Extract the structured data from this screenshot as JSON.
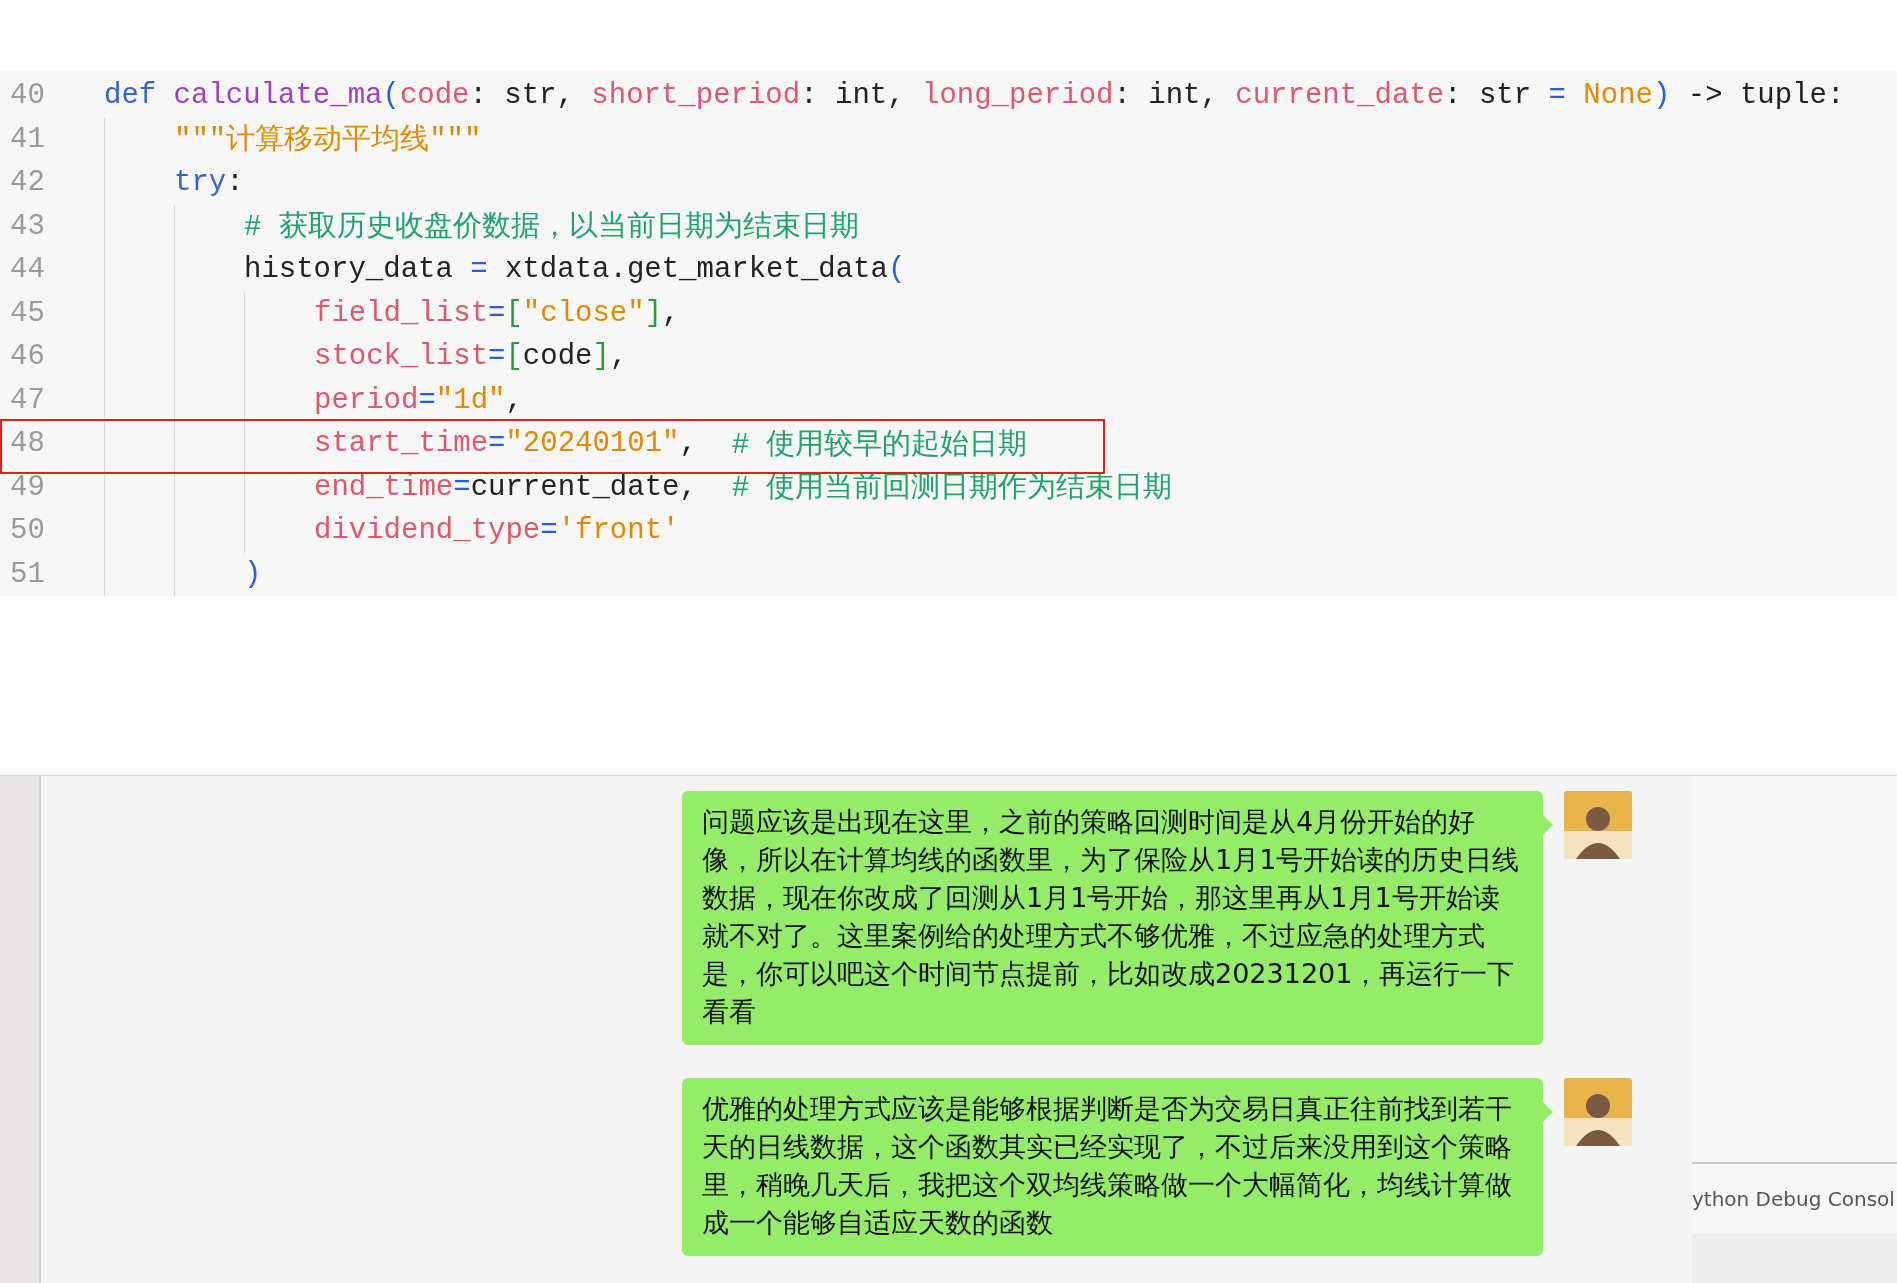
{
  "code_editor": {
    "lines": [
      {
        "number": "40",
        "tokens": [
          {
            "kind": "keyword",
            "text": "def"
          },
          {
            "kind": "function",
            "text": " calculate_ma"
          },
          {
            "kind": "paren",
            "text": "("
          },
          {
            "kind": "param",
            "text": "code"
          },
          {
            "kind": "plain",
            "text": ": str, "
          },
          {
            "kind": "param",
            "text": "short_period"
          },
          {
            "kind": "plain",
            "text": ": int, "
          },
          {
            "kind": "param",
            "text": "long_period"
          },
          {
            "kind": "plain",
            "text": ": int, "
          },
          {
            "kind": "param",
            "text": "current_date"
          },
          {
            "kind": "plain",
            "text": ": str "
          },
          {
            "kind": "operator",
            "text": "="
          },
          {
            "kind": "constant",
            "text": " None"
          },
          {
            "kind": "paren",
            "text": ")"
          },
          {
            "kind": "plain",
            "text": " -> tuple:"
          }
        ],
        "children": [
          {
            "number": "41",
            "tokens": [
              {
                "kind": "string",
                "text": "\"\"\"计算移动平均线\"\"\""
              }
            ]
          },
          {
            "number": "42",
            "tokens": [
              {
                "kind": "keyword",
                "text": "try"
              },
              {
                "kind": "plain",
                "text": ":"
              }
            ],
            "children": [
              {
                "number": "43",
                "tokens": [
                  {
                    "kind": "comment",
                    "text": "# 获取历史收盘价数据，以当前日期为结束日期"
                  }
                ]
              },
              {
                "number": "44",
                "tokens": [
                  {
                    "kind": "plain",
                    "text": "history_data "
                  },
                  {
                    "kind": "operator",
                    "text": "="
                  },
                  {
                    "kind": "plain",
                    "text": " xtdata.get_market_data"
                  },
                  {
                    "kind": "paren",
                    "text": "("
                  }
                ],
                "children": [
                  {
                    "number": "45",
                    "tokens": [
                      {
                        "kind": "param",
                        "text": "field_list"
                      },
                      {
                        "kind": "operator",
                        "text": "="
                      },
                      {
                        "kind": "bracket",
                        "text": "["
                      },
                      {
                        "kind": "string",
                        "text": "\"close\""
                      },
                      {
                        "kind": "bracket",
                        "text": "]"
                      },
                      {
                        "kind": "plain",
                        "text": ","
                      }
                    ]
                  },
                  {
                    "number": "46",
                    "tokens": [
                      {
                        "kind": "param",
                        "text": "stock_list"
                      },
                      {
                        "kind": "operator",
                        "text": "="
                      },
                      {
                        "kind": "bracket",
                        "text": "["
                      },
                      {
                        "kind": "plain",
                        "text": "code"
                      },
                      {
                        "kind": "bracket",
                        "text": "]"
                      },
                      {
                        "kind": "plain",
                        "text": ","
                      }
                    ]
                  },
                  {
                    "number": "47",
                    "tokens": [
                      {
                        "kind": "param",
                        "text": "period"
                      },
                      {
                        "kind": "operator",
                        "text": "="
                      },
                      {
                        "kind": "string",
                        "text": "\"1d\""
                      },
                      {
                        "kind": "plain",
                        "text": ","
                      }
                    ]
                  },
                  {
                    "number": "48",
                    "tokens": [
                      {
                        "kind": "param",
                        "text": "start_time"
                      },
                      {
                        "kind": "operator",
                        "text": "="
                      },
                      {
                        "kind": "string",
                        "text": "\"20240101\""
                      },
                      {
                        "kind": "plain",
                        "text": ",  "
                      },
                      {
                        "kind": "comment",
                        "text": "# 使用较早的起始日期"
                      }
                    ]
                  },
                  {
                    "number": "49",
                    "tokens": [
                      {
                        "kind": "param",
                        "text": "end_time"
                      },
                      {
                        "kind": "operator",
                        "text": "="
                      },
                      {
                        "kind": "plain",
                        "text": "current_date,  "
                      },
                      {
                        "kind": "comment",
                        "text": "# 使用当前回测日期作为结束日期"
                      }
                    ]
                  },
                  {
                    "number": "50",
                    "tokens": [
                      {
                        "kind": "param",
                        "text": "dividend_type"
                      },
                      {
                        "kind": "operator",
                        "text": "="
                      },
                      {
                        "kind": "string",
                        "text": "'front'"
                      }
                    ]
                  }
                ]
              },
              {
                "number": "51",
                "tokens": [
                  {
                    "kind": "paren",
                    "text": ")"
                  }
                ]
              }
            ]
          }
        ]
      }
    ]
  },
  "chat": {
    "messages": [
      {
        "text": "问题应该是出现在这里，之前的策略回测时间是从4月份开始的好像，所以在计算均线的函数里，为了保险从1月1号开始读的历史日线数据，现在你改成了回测从1月1号开始，那这里再从1月1号开始读就不对了。这里案例给的处理方式不够优雅，不过应急的处理方式是，你可以吧这个时间节点提前，比如改成20231201，再运行一下看看"
      },
      {
        "text": "优雅的处理方式应该是能够根据判断是否为交易日真正往前找到若干天的日线数据，这个函数其实已经实现了，不过后来没用到这个策略里，稍晚几天后，我把这个双均线策略做一个大幅简化，均线计算做成一个能够自适应天数的函数"
      }
    ]
  },
  "side_panel": {
    "tab_label": "ython Debug Consol"
  }
}
